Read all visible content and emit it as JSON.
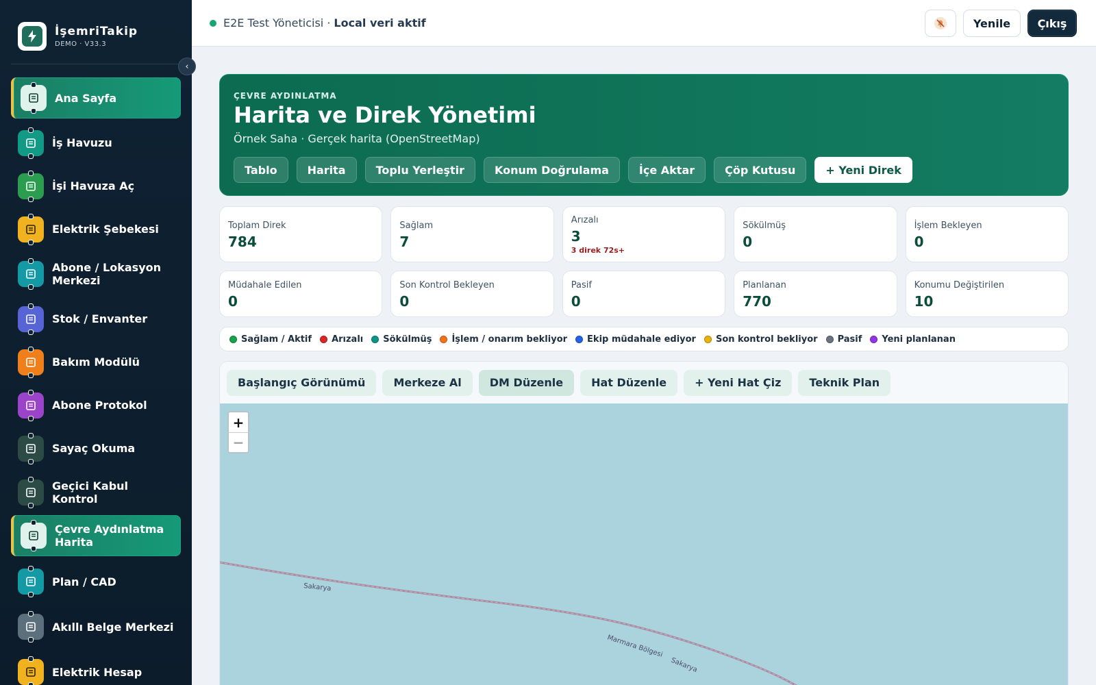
{
  "brand": {
    "name": "İşemriTakip",
    "version": "DEMO · V33.3"
  },
  "sidebar": {
    "items": [
      {
        "label": "Ana Sayfa",
        "icon": "home-icon",
        "color": "#dff3ec",
        "fg": "#0f3d30",
        "active": true
      },
      {
        "label": "İş Havuzu",
        "icon": "document-icon",
        "color": "#139a86",
        "fg": "#ffffff"
      },
      {
        "label": "İşi Havuza Aç",
        "icon": "plus-square-icon",
        "color": "#2a9d4f",
        "fg": "#ffffff"
      },
      {
        "label": "Elektrik Şebekesi",
        "icon": "power-tower-icon",
        "color": "#f0b21f",
        "fg": "#2b2100"
      },
      {
        "label": "Abone / Lokasyon Merkezi",
        "icon": "building-icon",
        "color": "#149aa4",
        "fg": "#ffffff"
      },
      {
        "label": "Stok / Envanter",
        "icon": "box-icon",
        "color": "#5664d6",
        "fg": "#ffffff"
      },
      {
        "label": "Bakım Modülü",
        "icon": "wrench-icon",
        "color": "#ef7f1a",
        "fg": "#ffffff"
      },
      {
        "label": "Abone Protokol",
        "icon": "protocol-doc-icon",
        "color": "#9b44c9",
        "fg": "#ffffff"
      },
      {
        "label": "Sayaç Okuma",
        "icon": "meter-icon",
        "color": "#2d4b45",
        "fg": "#ffffff"
      },
      {
        "label": "Geçici Kabul Kontrol",
        "icon": "checklist-icon",
        "color": "#2d4b45",
        "fg": "#ffffff"
      },
      {
        "label": "Çevre Aydınlatma Harita",
        "icon": "street-light-icon",
        "color": "#dff3ec",
        "fg": "#0f3d30",
        "active": true
      },
      {
        "label": "Plan / CAD",
        "icon": "blueprint-icon",
        "color": "#149aa4",
        "fg": "#ffffff"
      },
      {
        "label": "Akıllı Belge Merkezi",
        "icon": "smart-doc-icon",
        "color": "#5b6f7d",
        "fg": "#ffffff"
      },
      {
        "label": "Elektrik Hesap",
        "icon": "calculator-icon",
        "color": "#f0b21f",
        "fg": "#2b2100"
      }
    ]
  },
  "topbar": {
    "user": "E2E Test Yöneticisi ·",
    "mode": "Local veri aktif",
    "refresh_label": "Yenile",
    "exit_label": "Çıkış"
  },
  "hero": {
    "kicker": "ÇEVRE AYDINLATMA",
    "title": "Harita ve Direk Yönetimi",
    "subtitle": "Örnek Saha · Gerçek harita (OpenStreetMap)",
    "tabs": [
      "Tablo",
      "Harita",
      "Toplu Yerleştir",
      "Konum Doğrulama",
      "İçe Aktar",
      "Çöp Kutusu"
    ],
    "primary_tab": "+ Yeni Direk"
  },
  "stats": [
    {
      "label": "Toplam Direk",
      "value": "784"
    },
    {
      "label": "Sağlam",
      "value": "7"
    },
    {
      "label": "Arızalı",
      "value": "3",
      "note": "3 direk 72s+"
    },
    {
      "label": "Sökülmüş",
      "value": "0"
    },
    {
      "label": "İşlem Bekleyen",
      "value": "0"
    },
    {
      "label": "Müdahale Edilen",
      "value": "0"
    },
    {
      "label": "Son Kontrol Bekleyen",
      "value": "0"
    },
    {
      "label": "Pasif",
      "value": "0"
    },
    {
      "label": "Planlanan",
      "value": "770"
    },
    {
      "label": "Konumu Değiştirilen",
      "value": "10"
    }
  ],
  "legend": [
    {
      "label": "Sağlam / Aktif",
      "color": "#16a34a"
    },
    {
      "label": "Arızalı",
      "color": "#dc2626"
    },
    {
      "label": "Sökülmüş",
      "color": "#0d9488"
    },
    {
      "label": "İşlem / onarım bekliyor",
      "color": "#f97316"
    },
    {
      "label": "Ekip müdahale ediyor",
      "color": "#2563eb"
    },
    {
      "label": "Son kontrol bekliyor",
      "color": "#eab308"
    },
    {
      "label": "Pasif",
      "color": "#6b7280"
    },
    {
      "label": "Yeni planlanan",
      "color": "#9333ea"
    }
  ],
  "map_toolbar": [
    "Başlangıç Görünümü",
    "Merkeze Al",
    "DM Düzenle",
    "Hat Düzenle",
    "+ Yeni Hat Çiz",
    "Teknik Plan"
  ],
  "map": {
    "zoom_in": "+",
    "zoom_out": "−",
    "labels": [
      "Sakarya",
      "Marmara Bölgesi",
      "Sakarya"
    ]
  }
}
